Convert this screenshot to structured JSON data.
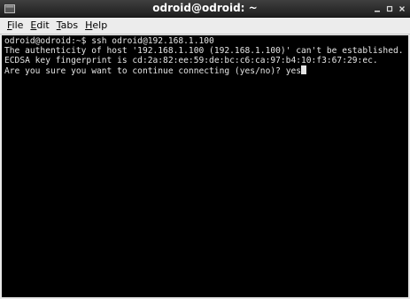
{
  "window": {
    "title": "odroid@odroid: ~",
    "controls": {
      "minimize_icon": "minimize-icon",
      "maximize_icon": "maximize-icon",
      "close_icon": "close-icon"
    }
  },
  "menu": {
    "items": [
      {
        "mnemonic": "F",
        "rest": "ile"
      },
      {
        "mnemonic": "E",
        "rest": "dit"
      },
      {
        "mnemonic": "T",
        "rest": "abs"
      },
      {
        "mnemonic": "H",
        "rest": "elp"
      }
    ]
  },
  "terminal": {
    "lines": [
      "odroid@odroid:~$ ssh odroid@192.168.1.100",
      "The authenticity of host '192.168.1.100 (192.168.1.100)' can't be established.",
      "ECDSA key fingerprint is cd:2a:82:ee:59:de:bc:c6:ca:97:b4:10:f3:67:29:ec."
    ],
    "prompt_line": "Are you sure you want to continue connecting (yes/no)? ",
    "typed_input": "yes"
  },
  "colors": {
    "terminal_bg": "#000000",
    "terminal_fg": "#e5e5e5",
    "titlebar": "#2a2a2a"
  }
}
